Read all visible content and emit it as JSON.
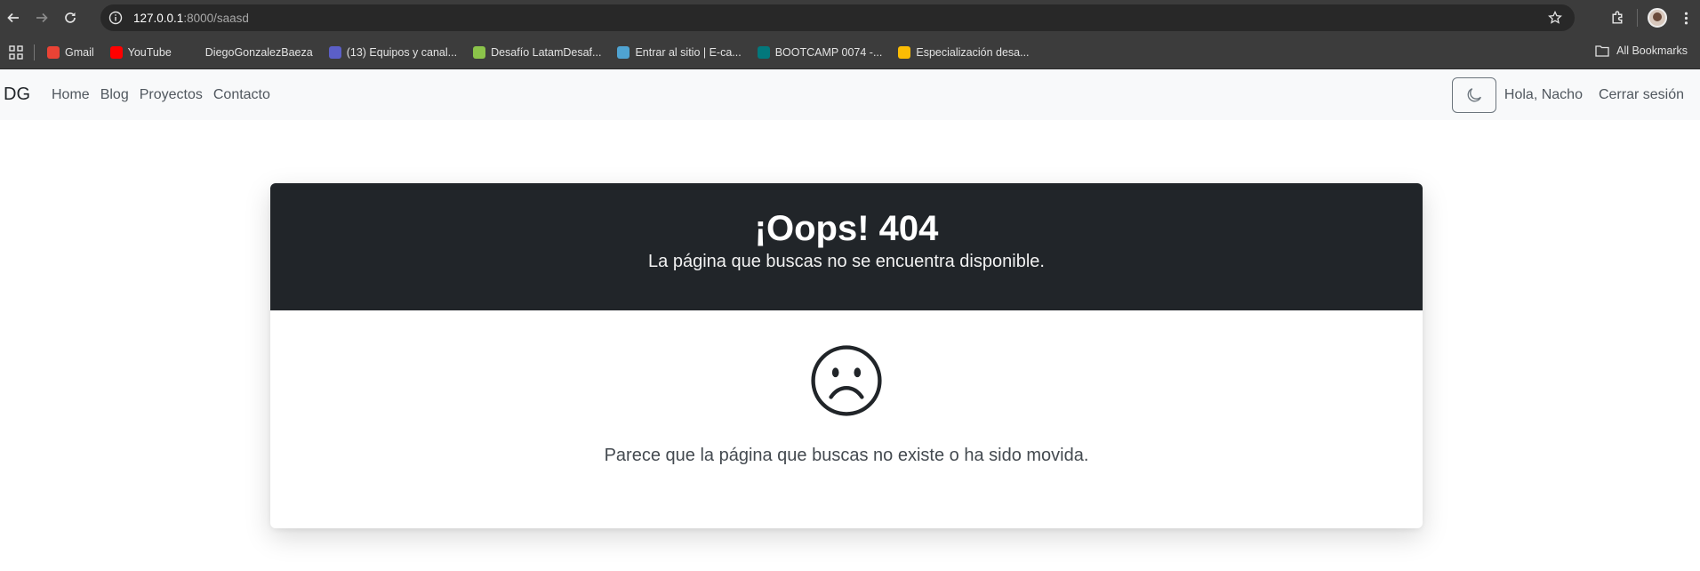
{
  "browser": {
    "url_host": "127.0.0.1",
    "url_path": ":8000/saasd",
    "bookmarks": [
      {
        "label": "Gmail",
        "color": "#ea4335"
      },
      {
        "label": "YouTube",
        "color": "#ff0000"
      },
      {
        "label": "DiegoGonzalezBaeza",
        "color": "#3c3c3c"
      },
      {
        "label": "(13) Equipos y canal...",
        "color": "#5b5fc7"
      },
      {
        "label": "Desafío LatamDesaf...",
        "color": "#8bc34a"
      },
      {
        "label": "Entrar al sitio | E-ca...",
        "color": "#4fa3d1"
      },
      {
        "label": "BOOTCAMP 0074 -...",
        "color": "#03787c"
      },
      {
        "label": "Especialización desa...",
        "color": "#fbbc04"
      }
    ],
    "all_bookmarks_label": "All Bookmarks"
  },
  "navbar": {
    "brand": "DG",
    "links": [
      "Home",
      "Blog",
      "Proyectos",
      "Contacto"
    ],
    "greeting": "Hola, Nacho",
    "logout": "Cerrar sesión",
    "theme_icon": "moon-icon"
  },
  "error": {
    "title": "¡Oops! 404",
    "subtitle": "La página que buscas no se encuentra disponible.",
    "icon": "sad-face-icon",
    "message": "Parece que la página que buscas no existe o ha sido movida."
  }
}
